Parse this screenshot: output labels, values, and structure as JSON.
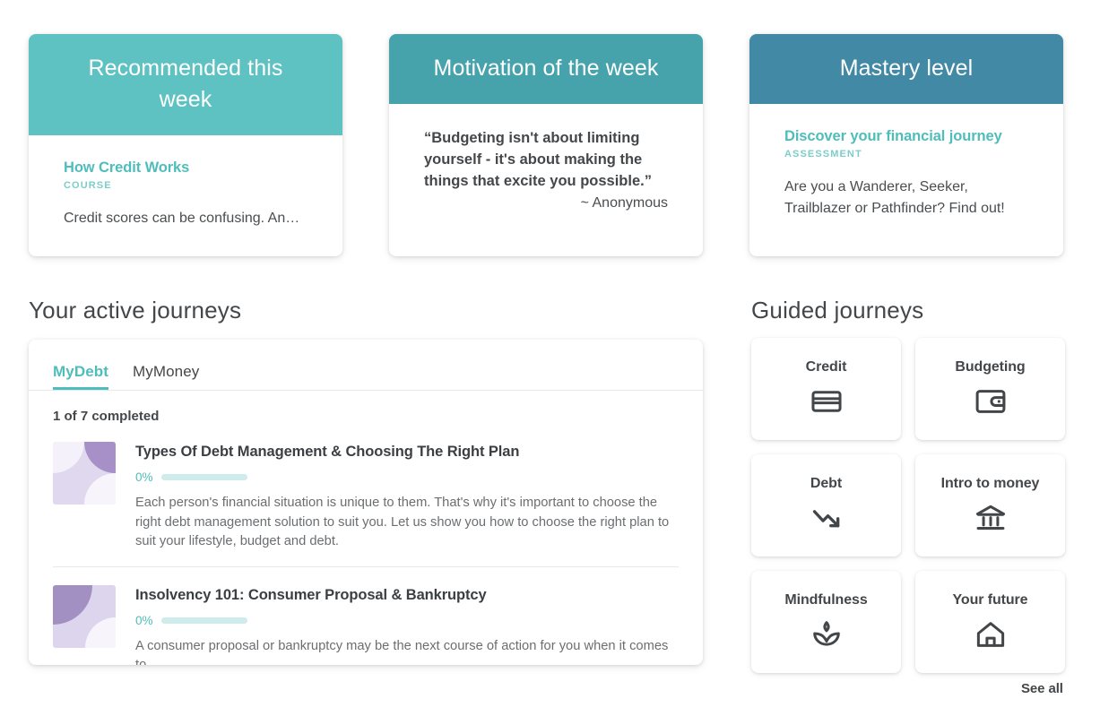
{
  "highlight_cards": [
    {
      "header": "Recommended this week",
      "header_color": "#5FC2C2",
      "title": "How Credit Works",
      "kicker": "COURSE",
      "description": "Credit scores can be confusing. An…",
      "two_line": true
    },
    {
      "header": "Motivation of the week",
      "header_color": "#46A3AC",
      "quote": "“Budgeting isn't about limiting yourself - it's about making the things that excite you possible.”",
      "author": "~ Anonymous",
      "two_line": false
    },
    {
      "header": "Mastery level",
      "header_color": "#4189A5",
      "title": "Discover your financial journey",
      "kicker": "ASSESSMENT",
      "description": "Are you a Wanderer, Seeker, Trailblazer or Pathfinder? Find out!",
      "two_line": false
    }
  ],
  "active_journeys": {
    "section_title": "Your active journeys",
    "tabs": [
      {
        "label": "MyDebt",
        "active": true
      },
      {
        "label": "MyMoney",
        "active": false
      }
    ],
    "progress_summary": "1 of 7 completed",
    "items": [
      {
        "title": "Types Of Debt Management & Choosing The Right Plan",
        "percent": "0%",
        "progress_value": 0,
        "description": "Each person's financial situation is unique to them. That's why it's important to choose the right debt management solution to suit you. Let us show you how to choose the right plan to suit your lifestyle, budget and debt."
      },
      {
        "title": "Insolvency 101: Consumer Proposal & Bankruptcy",
        "percent": "0%",
        "progress_value": 0,
        "description": "A consumer proposal or bankruptcy may be the next course of action for you when it comes to"
      }
    ]
  },
  "guided_journeys": {
    "section_title": "Guided journeys",
    "see_all_label": "See all",
    "tiles": [
      {
        "label": "Credit",
        "icon": "credit-card-icon"
      },
      {
        "label": "Budgeting",
        "icon": "wallet-icon"
      },
      {
        "label": "Debt",
        "icon": "trending-down-arrow-icon"
      },
      {
        "label": "Intro to money",
        "icon": "bank-building-icon"
      },
      {
        "label": "Mindfulness",
        "icon": "lotus-flower-icon"
      },
      {
        "label": "Your future",
        "icon": "home-icon"
      }
    ]
  },
  "theme": {
    "accent_teal": "#4FBDBA",
    "progress_track": "#CDECEB",
    "text_dark": "#44474A",
    "text_muted": "#6B6E71",
    "page_background": "#FFFFFF"
  }
}
